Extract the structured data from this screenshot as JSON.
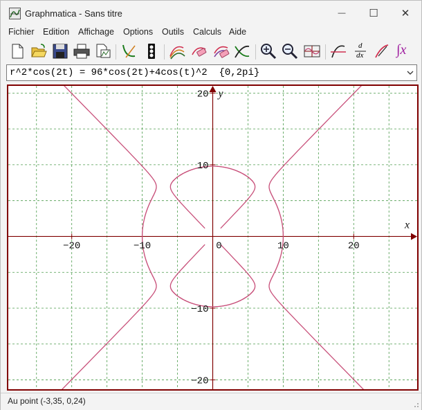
{
  "window": {
    "title": "Graphmatica - Sans titre",
    "minimize_glyph": "—",
    "maximize_glyph": "☐",
    "close_glyph": "✕"
  },
  "menu": [
    "Fichier",
    "Edition",
    "Affichage",
    "Options",
    "Outils",
    "Calculs",
    "Aide"
  ],
  "toolbar": {
    "icons": [
      "new-file-icon",
      "open-folder-icon",
      "save-disk-icon",
      "print-icon",
      "copy-graph-icon",
      "graph-curve-icon",
      "traffic-light-icon",
      "multi-curve-icon",
      "erase-curve-icon",
      "erase-all-icon",
      "intersection-icon",
      "zoom-in-icon",
      "zoom-out-icon",
      "grid-view-icon",
      "tangent-icon",
      "derivative-icon",
      "slope-icon",
      "integral-icon"
    ],
    "derivative_label_top": "d",
    "derivative_label_bottom": "dx",
    "integral_label": "∫x"
  },
  "equation": {
    "value": "r^2*cos(2t) = 96*cos(2t)+4cos(t)^2  {0,2pi}"
  },
  "chart_data": {
    "type": "line",
    "title": "",
    "xlabel": "x",
    "ylabel": "y",
    "xlim": [
      -29,
      29
    ],
    "ylim": [
      -21.3,
      21
    ],
    "grid": true,
    "x_tick_labels": [
      "−20",
      "−10",
      "0",
      "10",
      "20"
    ],
    "y_tick_labels": [
      "20",
      "10",
      "−10",
      "−20"
    ],
    "series": [
      {
        "equation": "r^2*cos(2t) = 96*cos(2t)+4cos(t)^2",
        "domain": "{0,2pi}",
        "color": "#c8507a",
        "points_desc": "polar curve r = sqrt(96 + 4cos²t / cos2t)"
      }
    ],
    "colors": {
      "axis": "#800000",
      "grid": "#4a9a4a",
      "curve": "#c8507a"
    }
  },
  "status": {
    "text": "Au point (-3,35, 0,24)"
  }
}
